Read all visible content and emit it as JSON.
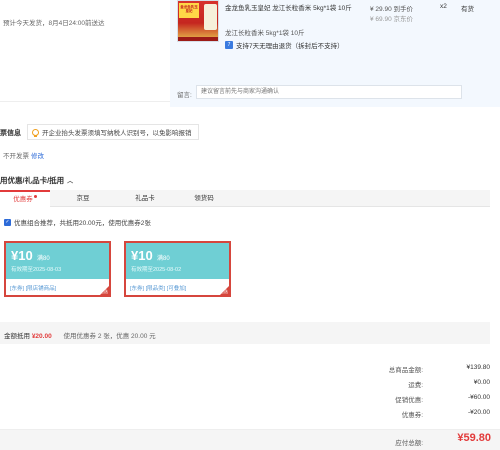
{
  "delivery": {
    "text": "预计今天发货，8月4日24:00前送达"
  },
  "product": {
    "image_alt": "金龙鱼乳玉皇妃 龙江长粒香米",
    "image_badge": "金龙鱼乳玉皇妃",
    "name": "金龙鱼乳玉皇妃 龙江长粒香米 5kg*1袋 10斤",
    "sku": "龙江长粒香米 5kg*1袋 10斤",
    "price": "¥ 29.90 到手价",
    "price_original": "¥ 69.90 京东价",
    "qty": "x2",
    "stock": "有货",
    "return_icon": "7",
    "return_policy": "支持7天无理由退货（拆封后不支持）",
    "remark_label": "留言:",
    "remark_placeholder": "建议留言前先与商家沟通确认"
  },
  "invoice": {
    "title": "票信息",
    "tip": "开企业抬头发票须填写纳税人识别号，以免影响报销",
    "status": "不开发票",
    "edit": "修改"
  },
  "coupons": {
    "title": "用优惠/礼品卡/抵用",
    "toggle_icon": "chevron-up-icon",
    "tabs": [
      {
        "label": "优惠券",
        "active": true
      },
      {
        "label": "京豆",
        "active": false
      },
      {
        "label": "礼品卡",
        "active": false
      },
      {
        "label": "领货码",
        "active": false
      }
    ],
    "combo_text": "优惠组合推荐，共抵用20.00元，使用优惠券2张",
    "items": [
      {
        "amount": "¥10",
        "condition": "满80",
        "expiry": "有效期至2025-08-03",
        "tags": "[东券]  [限店铺商品]",
        "corner": "已选"
      },
      {
        "amount": "¥10",
        "condition": "满80",
        "expiry": "有效期至2025-08-02",
        "tags": "[东券]  [限品类]  [可叠加]",
        "corner": "已选"
      }
    ],
    "deduct_label": "金额抵用",
    "deduct_amount": "¥20.00",
    "deduct_detail": "使用优惠券 2 张，优惠 20.00 元"
  },
  "summary": {
    "rows": [
      {
        "label": "总商品金额:",
        "value": "¥139.80"
      },
      {
        "label": "运费:",
        "value": "¥0.00"
      },
      {
        "label": "促销优惠:",
        "value": "-¥60.00"
      },
      {
        "label": "优惠券:",
        "value": "-¥20.00"
      }
    ],
    "total_label": "应付总额:",
    "total_value": "¥59.80"
  },
  "colors": {
    "accent": "#e23b3b",
    "link": "#2d6bd8",
    "coupon_band": "#6fcfd4",
    "product_bg": "#f3f8fe"
  }
}
